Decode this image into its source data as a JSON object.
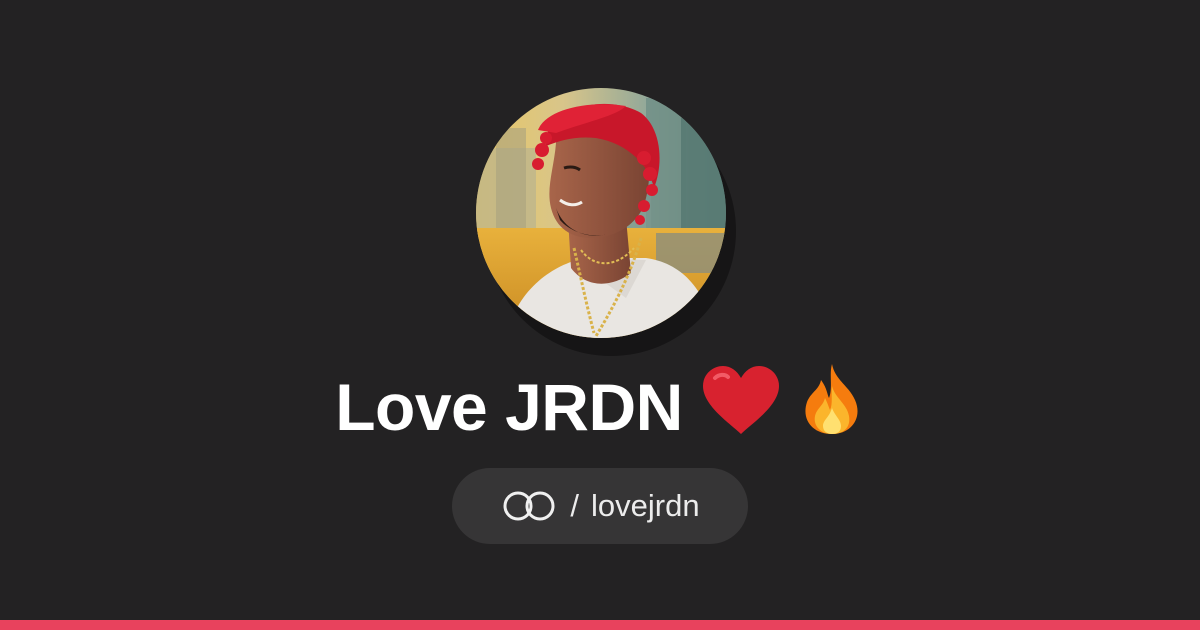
{
  "profile": {
    "display_name": "Love JRDN",
    "emojis": [
      "heart-emoji",
      "fire-emoji"
    ],
    "handle_separator": "/",
    "username": "lovejrdn"
  },
  "colors": {
    "background": "#232223",
    "pill_background": "#363536",
    "accent_bar": "#e8425d",
    "text": "#ffffff"
  },
  "icons": {
    "brand_logo": "linked-rings-icon"
  }
}
